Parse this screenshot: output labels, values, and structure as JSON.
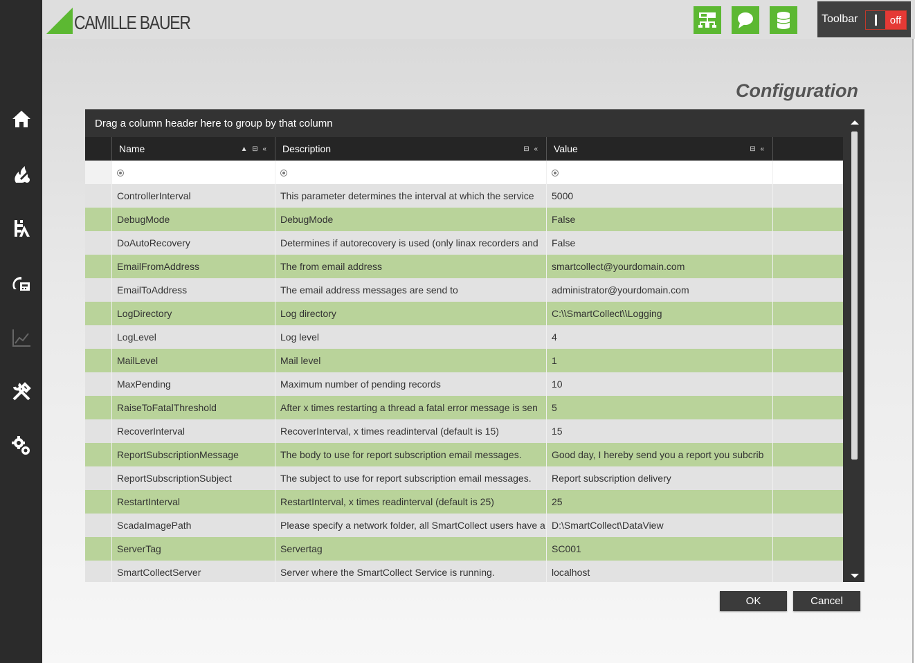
{
  "app": {
    "brand_name": "CAMILLE BAUER",
    "brand_color": "#5cb832"
  },
  "sidebar": {
    "items": [
      {
        "icon": "home-icon"
      },
      {
        "icon": "fire-wrench-icon"
      },
      {
        "icon": "building-icon"
      },
      {
        "icon": "meter-icon"
      },
      {
        "icon": "chart-icon"
      },
      {
        "icon": "tools-icon"
      },
      {
        "icon": "gears-icon"
      }
    ]
  },
  "header": {
    "buttons": [
      {
        "icon": "network-icon"
      },
      {
        "icon": "chat-icon"
      },
      {
        "icon": "database-icon"
      }
    ],
    "toolbar_label": "Toolbar",
    "toggle_state": "off"
  },
  "page": {
    "title": "Configuration"
  },
  "grid": {
    "group_hint": "Drag a column header here to group by that column",
    "columns": [
      "Name",
      "Description",
      "Value"
    ],
    "rows": [
      {
        "name": "ControllerInterval",
        "description": "This parameter determines the interval at which the service",
        "value": "5000"
      },
      {
        "name": "DebugMode",
        "description": "DebugMode",
        "value": "False"
      },
      {
        "name": "DoAutoRecovery",
        "description": "Determines if autorecovery is used (only linax recorders and",
        "value": "False"
      },
      {
        "name": "EmailFromAddress",
        "description": "The from email address",
        "value": "smartcollect@yourdomain.com"
      },
      {
        "name": "EmailToAddress",
        "description": "The email address messages are send to",
        "value": "administrator@yourdomain.com"
      },
      {
        "name": "LogDirectory",
        "description": "Log directory",
        "value": "C:\\\\SmartCollect\\\\Logging"
      },
      {
        "name": "LogLevel",
        "description": "Log level",
        "value": "4"
      },
      {
        "name": "MailLevel",
        "description": "Mail level",
        "value": "1"
      },
      {
        "name": "MaxPending",
        "description": "Maximum number of pending records",
        "value": "10"
      },
      {
        "name": "RaiseToFatalThreshold",
        "description": "After x times restarting a thread a fatal error message is sen",
        "value": "5"
      },
      {
        "name": "RecoverInterval",
        "description": "RecoverInterval, x times readinterval (default is 15)",
        "value": "15"
      },
      {
        "name": "ReportSubscriptionMessage",
        "description": "The body to use for report subscription email messages.",
        "value": "Good day, I hereby send you a report you subcrib"
      },
      {
        "name": "ReportSubscriptionSubject",
        "description": "The subject to use for report subscription email messages.",
        "value": "Report subscription delivery"
      },
      {
        "name": "RestartInterval",
        "description": "RestartInterval, x times readinterval (default is 25)",
        "value": "25"
      },
      {
        "name": "ScadaImagePath",
        "description": "Please specify a network folder, all SmartCollect users have a",
        "value": "D:\\SmartCollect\\DataView"
      },
      {
        "name": "ServerTag",
        "description": "Servertag",
        "value": "SC001"
      },
      {
        "name": "SmartCollectServer",
        "description": "Server where the SmartCollect Service is running.",
        "value": "localhost"
      }
    ]
  },
  "actions": {
    "ok_label": "OK",
    "cancel_label": "Cancel"
  }
}
